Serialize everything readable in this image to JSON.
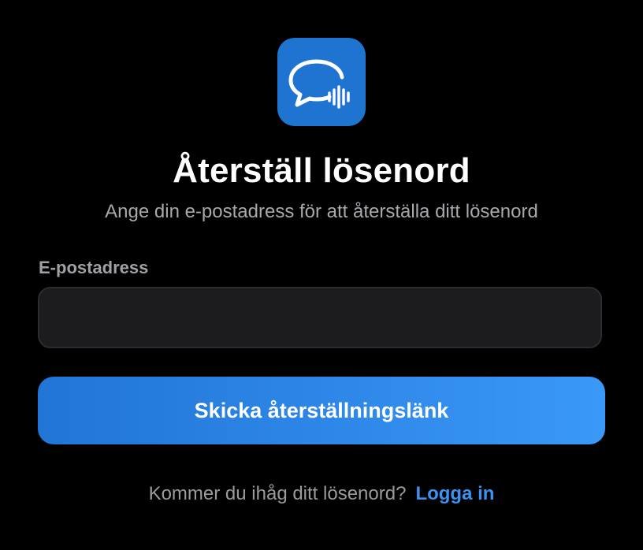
{
  "app": {
    "logo_icon": "chat-bubble-soundwave-icon",
    "brand_color": "#1f74d2"
  },
  "reset": {
    "title": "Återställ lösenord",
    "subtitle": "Ange din e-postadress för att återställa ditt lösenord",
    "email_label": "E-postadress",
    "email_value": "",
    "email_placeholder": "",
    "submit_label": "Skicka återställningslänk",
    "accent_gradient": [
      "#2175d6",
      "#3a98f8"
    ]
  },
  "footer": {
    "question": "Kommer du ihåg ditt lösenord?",
    "login_label": "Logga in",
    "link_color": "#3a93f2"
  }
}
